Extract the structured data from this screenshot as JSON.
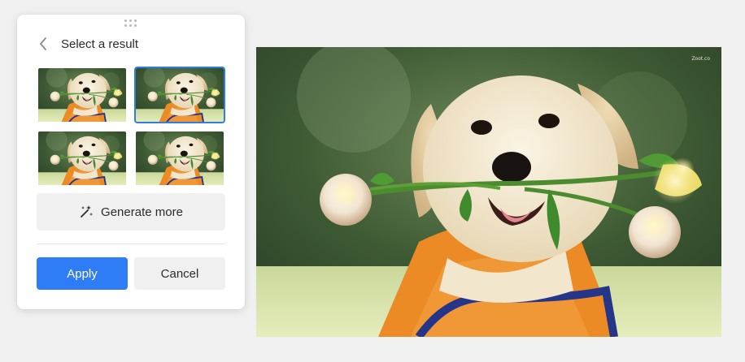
{
  "panel": {
    "title": "Select a result",
    "thumbnails": [
      {
        "selected": false
      },
      {
        "selected": true
      },
      {
        "selected": false
      },
      {
        "selected": false
      }
    ],
    "generate_label": "Generate more",
    "apply_label": "Apply",
    "cancel_label": "Cancel"
  },
  "preview": {
    "watermark": "Zoot.co"
  },
  "colors": {
    "accent": "#2f7df6",
    "selected_border": "#2f7de1"
  }
}
